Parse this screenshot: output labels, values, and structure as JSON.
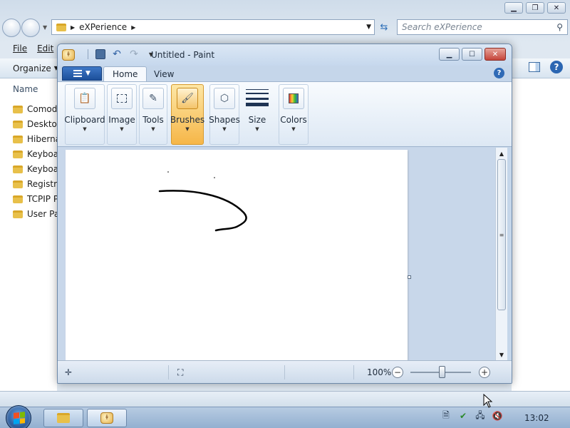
{
  "explorer": {
    "address": {
      "segments": [
        "eXPerience"
      ]
    },
    "search": {
      "placeholder": "Search eXPerience"
    },
    "menu": {
      "file": "File",
      "edit": "Edit"
    },
    "commands": {
      "organize": "Organize"
    },
    "list": {
      "column_name": "Name",
      "items": [
        "Comodo",
        "Desktop",
        "Hibernate",
        "Keyboard",
        "Keyboard",
        "Registry",
        "TCPIP P",
        "User Pass"
      ]
    }
  },
  "paint": {
    "title": "Untitled - Paint",
    "tabs": {
      "home": "Home",
      "view": "View"
    },
    "ribbon": {
      "groups": [
        {
          "label": "Clipboard",
          "icon": "clipboard-icon"
        },
        {
          "label": "Image",
          "icon": "select-icon"
        },
        {
          "label": "Tools",
          "icon": "tools-icon"
        },
        {
          "label": "Brushes",
          "icon": "brush-icon",
          "active": true
        },
        {
          "label": "Shapes",
          "icon": "shapes-icon"
        },
        {
          "label": "Size",
          "icon": "size-icon"
        },
        {
          "label": "Colors",
          "icon": "colors-icon"
        }
      ]
    },
    "status": {
      "zoom": "100%"
    }
  },
  "taskbar": {
    "clock": "13:02"
  },
  "colors": {
    "accent": "#f6b648",
    "ribbon_blue": "#1c4f9a",
    "close_red": "#c5443a"
  }
}
